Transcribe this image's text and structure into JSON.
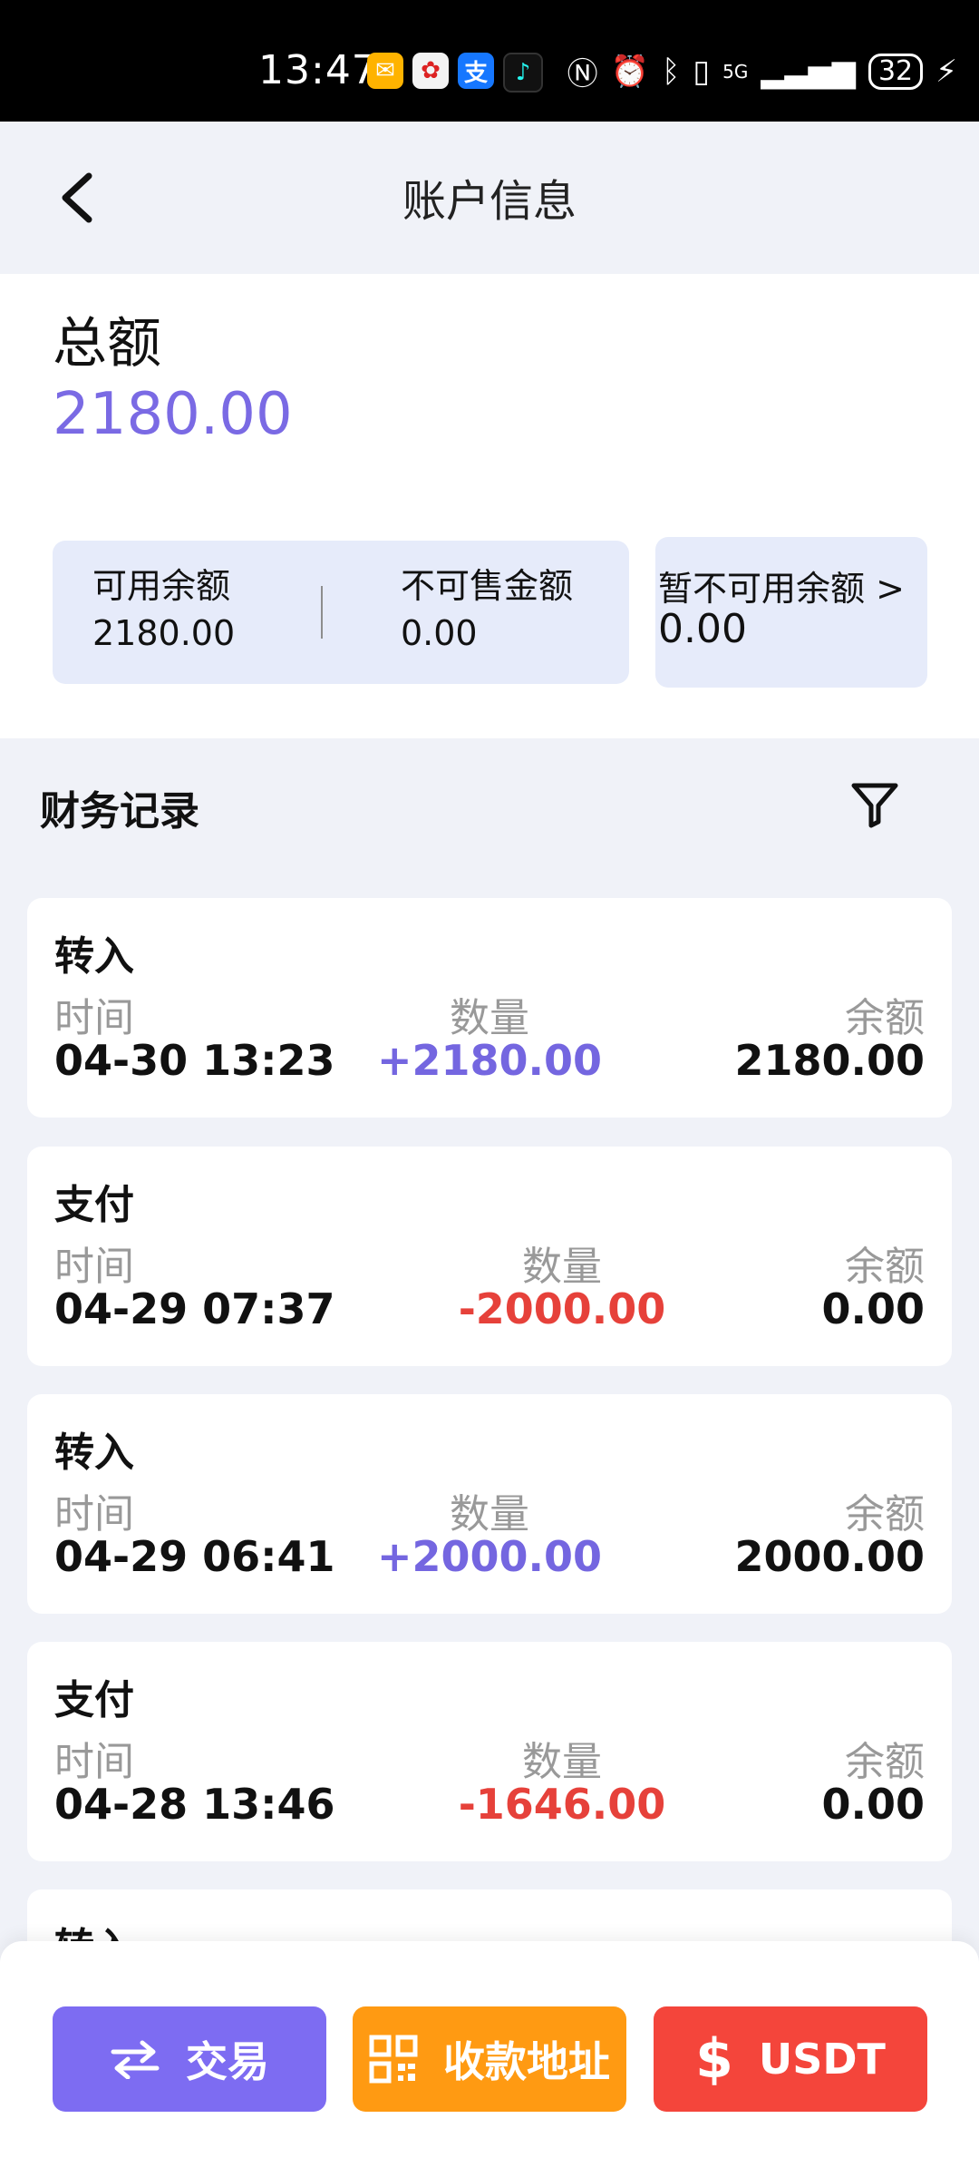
{
  "status_bar": {
    "time": "13:47",
    "network": "5G",
    "battery": "32",
    "app_icons": [
      "mail-icon",
      "huawei-icon",
      "alipay-icon",
      "tiktok-icon"
    ]
  },
  "header": {
    "title": "账户信息"
  },
  "account": {
    "total_label": "总额",
    "total_value": "2180.00",
    "available_label": "可用余额",
    "available_value": "2180.00",
    "unsellable_label": "不可售金额",
    "unsellable_value": "0.00",
    "unavailable_label": "暂不可用余额 >",
    "unavailable_value": "0.00"
  },
  "records": {
    "title": "财务记录",
    "items": [
      {
        "type": "转入",
        "time_label": "时间",
        "time": "04-30 13:23",
        "amount_label": "数量",
        "amount": "+2180.00",
        "balance_label": "余额",
        "balance": "2180.00"
      },
      {
        "type": "支付",
        "time_label": "时间",
        "time": "04-29 07:37",
        "amount_label": "数量",
        "amount": "-2000.00",
        "balance_label": "余额",
        "balance": "0.00"
      },
      {
        "type": "转入",
        "time_label": "时间",
        "time": "04-29 06:41",
        "amount_label": "数量",
        "amount": "+2000.00",
        "balance_label": "余额",
        "balance": "2000.00"
      },
      {
        "type": "支付",
        "time_label": "时间",
        "time": "04-28 13:46",
        "amount_label": "数量",
        "amount": "-1646.00",
        "balance_label": "余额",
        "balance": "0.00"
      },
      {
        "type": "转入"
      }
    ]
  },
  "bottom_bar": {
    "trade_label": "交易",
    "address_label": "收款地址",
    "usdt_label": "USDT"
  },
  "colors": {
    "accent_purple": "#7d6cf2",
    "positive": "#7466e0",
    "negative": "#e6413a",
    "orange": "#ff9a12",
    "red": "#f4453b"
  }
}
